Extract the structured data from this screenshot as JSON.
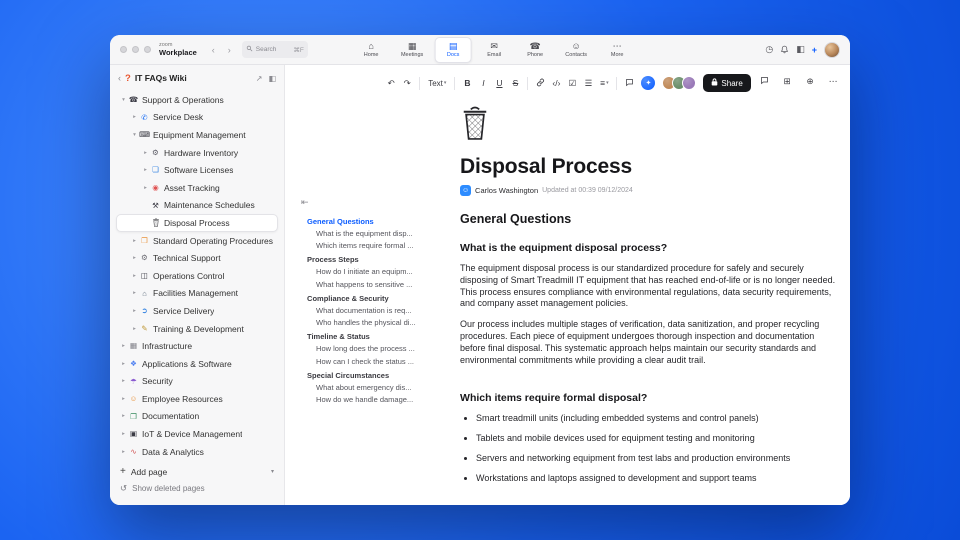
{
  "accent_color": "#0b5cff",
  "titlebar": {
    "logo_line1": "zoom",
    "logo_line2": "Workplace",
    "nav_back": "‹",
    "nav_forward": "›",
    "search": {
      "placeholder": "Search",
      "shortcut": "⌘F"
    },
    "tabs": [
      {
        "label": "Home",
        "icon": "⌂",
        "active": false
      },
      {
        "label": "Meetings",
        "icon": "▦",
        "active": false
      },
      {
        "label": "Docs",
        "icon": "▤",
        "active": true
      },
      {
        "label": "Email",
        "icon": "✉",
        "active": false
      },
      {
        "label": "Phone",
        "icon": "☎",
        "active": false
      },
      {
        "label": "Contacts",
        "icon": "☺",
        "active": false
      },
      {
        "label": "More",
        "icon": "⋯",
        "active": false
      }
    ],
    "right_icons": [
      {
        "name": "history",
        "glyph": "◷"
      },
      {
        "name": "notifications",
        "svg": "bell"
      },
      {
        "name": "panel-toggle",
        "glyph": "◧"
      },
      {
        "name": "new-item",
        "glyph": "+",
        "accent": true
      }
    ]
  },
  "sidebar": {
    "back_icon": "‹",
    "badge": "?",
    "title": "IT FAQs Wiki",
    "actions": [
      {
        "name": "open-external",
        "glyph": "↗"
      },
      {
        "name": "panel-toggle",
        "glyph": "◧"
      }
    ],
    "tree": [
      {
        "label": "Support & Operations",
        "level": 0,
        "icon": "☎",
        "icon_color": "#3a3a44",
        "expand": "down"
      },
      {
        "label": "Service Desk",
        "level": 1,
        "icon": "✆",
        "icon_color": "#1a6ef5",
        "expand": "right"
      },
      {
        "label": "Equipment Management",
        "level": 1,
        "icon": "⌨",
        "icon_color": "#2f2f38",
        "expand": "down"
      },
      {
        "label": "Hardware Inventory",
        "level": 2,
        "icon": "⚙",
        "icon_color": "#5a5a64",
        "expand": "right"
      },
      {
        "label": "Software Licenses",
        "level": 2,
        "icon": "❏",
        "icon_color": "#2a7de0",
        "expand": "right"
      },
      {
        "label": "Asset Tracking",
        "level": 2,
        "icon": "◉",
        "icon_color": "#e05252",
        "expand": "right"
      },
      {
        "label": "Maintenance Schedules",
        "level": 2,
        "icon": "⚒",
        "icon_color": "#3a3a44",
        "expand": "none"
      },
      {
        "label": "Disposal Process",
        "level": 2,
        "icon": "trash",
        "icon_color": "#26262a",
        "expand": "none",
        "selected": true
      },
      {
        "label": "Standard Operating Procedures",
        "level": 1,
        "icon": "❒",
        "icon_color": "#e8923a",
        "expand": "right"
      },
      {
        "label": "Technical Support",
        "level": 1,
        "icon": "⚙",
        "icon_color": "#6a6a72",
        "expand": "right"
      },
      {
        "label": "Operations Control",
        "level": 1,
        "icon": "◫",
        "icon_color": "#3a3a44",
        "expand": "right"
      },
      {
        "label": "Facilities Management",
        "level": 1,
        "icon": "⌂",
        "icon_color": "#5a6a7a",
        "expand": "right"
      },
      {
        "label": "Service Delivery",
        "level": 1,
        "icon": "➲",
        "icon_color": "#2a7de0",
        "expand": "right"
      },
      {
        "label": "Training & Development",
        "level": 1,
        "icon": "✎",
        "icon_color": "#c09a3a",
        "expand": "right"
      },
      {
        "label": "Infrastructure",
        "level": 0,
        "icon": "▦",
        "icon_color": "#7a7a82",
        "expand": "right"
      },
      {
        "label": "Applications & Software",
        "level": 0,
        "icon": "❖",
        "icon_color": "#4a7df0",
        "expand": "right"
      },
      {
        "label": "Security",
        "level": 0,
        "icon": "☂",
        "icon_color": "#8a5ad0",
        "expand": "right"
      },
      {
        "label": "Employee Resources",
        "level": 0,
        "icon": "☺",
        "icon_color": "#e8923a",
        "expand": "right"
      },
      {
        "label": "Documentation",
        "level": 0,
        "icon": "❐",
        "icon_color": "#3a8d5f",
        "expand": "right"
      },
      {
        "label": "IoT & Device Management",
        "level": 0,
        "icon": "▣",
        "icon_color": "#3a3a44",
        "expand": "right"
      },
      {
        "label": "Data & Analytics",
        "level": 0,
        "icon": "∿",
        "icon_color": "#d05252",
        "expand": "right"
      }
    ],
    "footer": {
      "add_icon": "+",
      "add_label": "Add page",
      "sort_icon": "▾",
      "deleted_icon": "↺",
      "deleted_label": "Show deleted pages"
    }
  },
  "toolbar": {
    "buttons": [
      {
        "name": "undo",
        "glyph": "↶"
      },
      {
        "name": "redo",
        "glyph": "↷"
      },
      {
        "type": "divider"
      },
      {
        "name": "text-style",
        "label": "Text"
      },
      {
        "type": "divider"
      },
      {
        "name": "bold",
        "glyph": "B"
      },
      {
        "name": "italic",
        "glyph": "I"
      },
      {
        "name": "underline",
        "glyph": "U"
      },
      {
        "name": "strikethrough",
        "glyph": "S"
      },
      {
        "type": "divider"
      },
      {
        "name": "link",
        "svg": "link"
      },
      {
        "name": "code",
        "glyph": "‹/›"
      },
      {
        "name": "checklist",
        "glyph": "☑"
      },
      {
        "name": "bulleted-list",
        "glyph": "☰"
      },
      {
        "name": "align",
        "glyph": "≡",
        "dropdown": true
      },
      {
        "type": "divider"
      },
      {
        "name": "comment",
        "svg": "bubble"
      }
    ],
    "ai_glyph": "✦",
    "collaborators": [
      "#c08a5a",
      "#6b8f6b",
      "#9a7ab8"
    ],
    "share_label": "Share",
    "right": [
      {
        "name": "comments",
        "svg": "bubble"
      },
      {
        "name": "apps-grid",
        "glyph": "⊞"
      },
      {
        "name": "publish",
        "glyph": "⊕"
      },
      {
        "name": "more-options",
        "glyph": "⋯"
      }
    ],
    "collapse_toc_icon": "⇤"
  },
  "doc": {
    "title": "Disposal Process",
    "author": "Carlos Washington",
    "updated_text": "Updated at 00:39 09/12/2024",
    "toc": [
      {
        "label": "General Questions",
        "level": 0,
        "active": true
      },
      {
        "label": "What is the equipment disp...",
        "level": 1
      },
      {
        "label": "Which items require formal ...",
        "level": 1
      },
      {
        "label": "Process Steps",
        "level": 0
      },
      {
        "label": "How do I initiate an equipm...",
        "level": 1
      },
      {
        "label": "What happens to sensitive ...",
        "level": 1
      },
      {
        "label": "Compliance & Security",
        "level": 0
      },
      {
        "label": "What documentation is req...",
        "level": 1
      },
      {
        "label": "Who handles the physical di...",
        "level": 1
      },
      {
        "label": "Timeline & Status",
        "level": 0
      },
      {
        "label": "How long does the process ...",
        "level": 1
      },
      {
        "label": "How can I check the status ...",
        "level": 1
      },
      {
        "label": "Special Circumstances",
        "level": 0
      },
      {
        "label": "What about emergency dis...",
        "level": 1
      },
      {
        "label": "How do we handle damage...",
        "level": 1
      }
    ],
    "h2": "General Questions",
    "q1": "What is the equipment disposal process?",
    "p1": "The equipment disposal process is our standardized procedure for safely and securely disposing of Smart Treadmill IT equipment that has reached end-of-life or is no longer needed. This process ensures compliance with environmental regulations, data security requirements, and company asset management policies.",
    "p2": "Our process includes multiple stages of verification, data sanitization, and proper recycling procedures. Each piece of equipment undergoes thorough inspection and documentation before final disposal. This systematic approach helps maintain our security standards and environmental commitments while providing a clear audit trail.",
    "q2": "Which items require formal disposal?",
    "bullets": [
      "Smart treadmill units (including embedded systems and control panels)",
      "Tablets and mobile devices used for equipment testing and monitoring",
      "Servers and networking equipment from test labs and production environments",
      "Workstations and laptops assigned to development and support teams"
    ]
  }
}
